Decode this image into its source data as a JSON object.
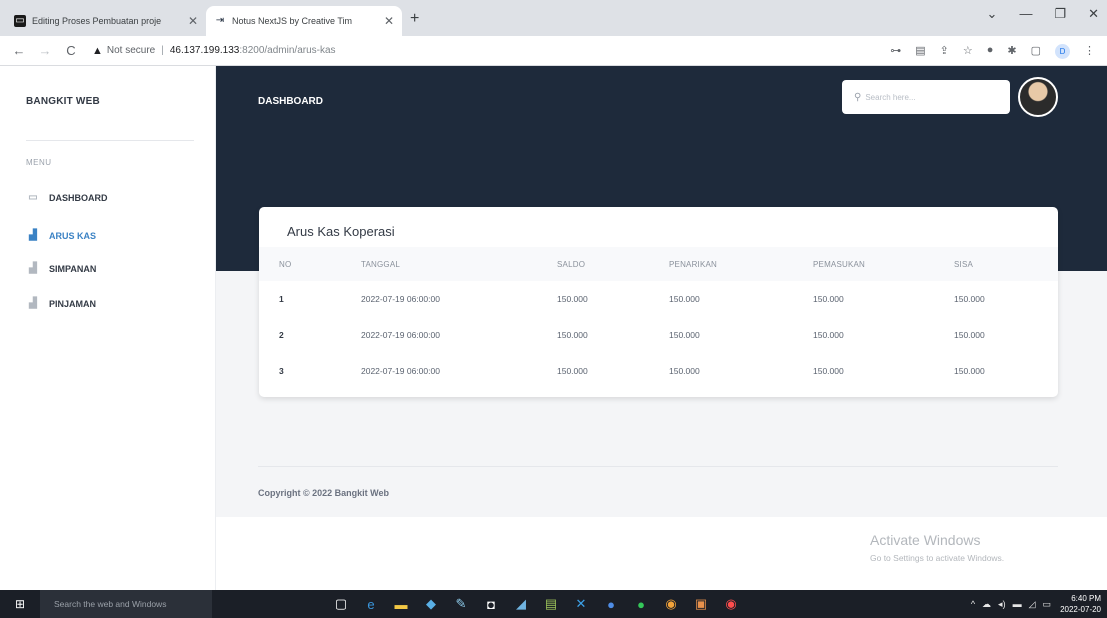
{
  "browser": {
    "tabs": [
      {
        "label": "Editing Proses Pembuatan proje",
        "favicon": "slides-icon"
      },
      {
        "label": "Notus NextJS by Creative Tim",
        "favicon": "notus-icon"
      }
    ],
    "security_label": "Not secure",
    "url_host": "46.137.199.133",
    "url_path": ":8200/admin/arus-kas",
    "profile_initial": "D"
  },
  "sidebar": {
    "brand": "BANGKIT WEB",
    "menu_heading": "MENU",
    "items": [
      {
        "label": "DASHBOARD",
        "icon": "monitor-icon",
        "active": false
      },
      {
        "label": "ARUS KAS",
        "icon": "chart-icon",
        "active": true
      },
      {
        "label": "SIMPANAN",
        "icon": "chart-icon",
        "active": false
      },
      {
        "label": "PINJAMAN",
        "icon": "chart-icon",
        "active": false
      }
    ]
  },
  "header": {
    "title": "DASHBOARD",
    "search_placeholder": "Search here..."
  },
  "card": {
    "title": "Arus Kas Koperasi",
    "columns": [
      "NO",
      "TANGGAL",
      "SALDO",
      "PENARIKAN",
      "PEMASUKAN",
      "SISA"
    ],
    "rows": [
      [
        "1",
        "2022-07-19 06:00:00",
        "150.000",
        "150.000",
        "150.000",
        "150.000"
      ],
      [
        "2",
        "2022-07-19 06:00:00",
        "150.000",
        "150.000",
        "150.000",
        "150.000"
      ],
      [
        "3",
        "2022-07-19 06:00:00",
        "150.000",
        "150.000",
        "150.000",
        "150.000"
      ]
    ]
  },
  "footer": {
    "copyright": "Copyright © 2022 Bangkit Web"
  },
  "watermark": {
    "line1": "Activate Windows",
    "line2": "Go to Settings to activate Windows."
  },
  "taskbar": {
    "search_placeholder": "Search the web and Windows",
    "time": "6:40 PM",
    "date": "2022-07-20"
  },
  "colors": {
    "hero": "#1e2a3b",
    "accent": "#3b82c4",
    "content_bg": "#f4f5f7"
  }
}
